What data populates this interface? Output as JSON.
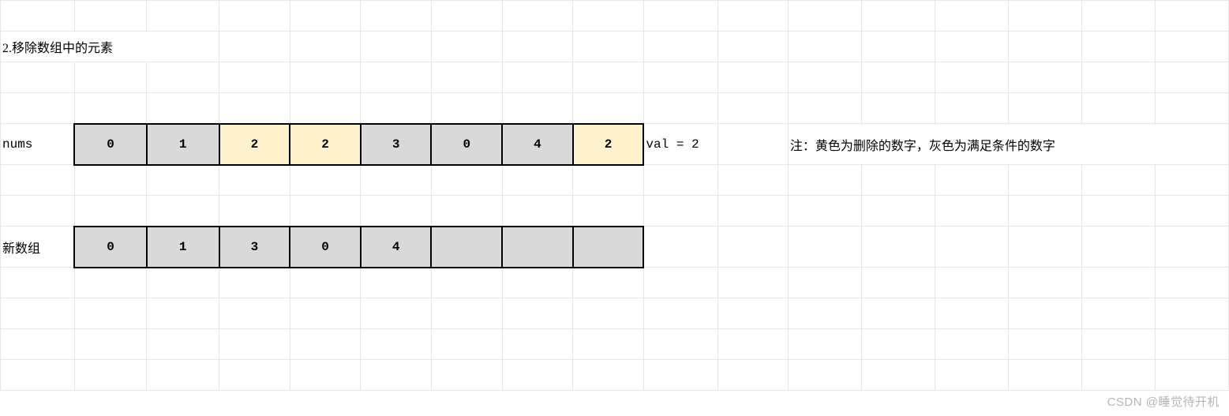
{
  "title": "2.移除数组中的元素",
  "labels": {
    "nums": "nums",
    "new_array": "新数组"
  },
  "val_text": "val = 2",
  "note": "注：黄色为删除的数字，灰色为满足条件的数字",
  "arrays": {
    "nums": [
      {
        "v": "0",
        "cls": "gray"
      },
      {
        "v": "1",
        "cls": "gray"
      },
      {
        "v": "2",
        "cls": "yellow"
      },
      {
        "v": "2",
        "cls": "yellow"
      },
      {
        "v": "3",
        "cls": "gray"
      },
      {
        "v": "0",
        "cls": "gray"
      },
      {
        "v": "4",
        "cls": "gray"
      },
      {
        "v": "2",
        "cls": "yellow"
      }
    ],
    "new": [
      {
        "v": "0",
        "cls": "gray"
      },
      {
        "v": "1",
        "cls": "gray"
      },
      {
        "v": "3",
        "cls": "gray"
      },
      {
        "v": "0",
        "cls": "gray"
      },
      {
        "v": "4",
        "cls": "gray"
      },
      {
        "v": "",
        "cls": "gray"
      },
      {
        "v": "",
        "cls": "gray"
      },
      {
        "v": "",
        "cls": "gray"
      }
    ]
  },
  "watermark": "CSDN @睡觉待开机",
  "chart_data": {
    "type": "table",
    "description": "Remove element from array illustration",
    "val": 2,
    "input_array": [
      0,
      1,
      2,
      2,
      3,
      0,
      4,
      2
    ],
    "output_array": [
      0,
      1,
      3,
      0,
      4
    ],
    "output_length": 8,
    "color_legend": {
      "yellow": "deleted",
      "gray": "kept"
    }
  }
}
